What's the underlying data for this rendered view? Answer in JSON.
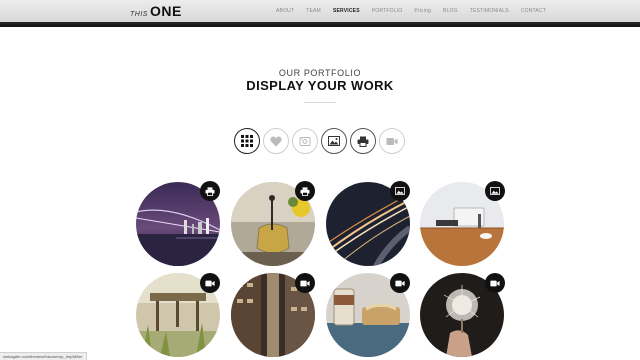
{
  "header": {
    "logo_prefix": "THIS",
    "logo_main": "ONE",
    "nav": [
      "ABOUT",
      "TEAM",
      "SERVICES",
      "PORTFOLIO",
      "Pricing",
      "BLOG",
      "TESTIMONIALS",
      "CONTACT"
    ],
    "active_nav": "SERVICES"
  },
  "portfolio": {
    "eyebrow": "OUR PORTFOLIO",
    "title": "DISPLAY YOUR WORK",
    "filters": [
      "grid-icon",
      "heart-icon",
      "camera-icon",
      "image-icon",
      "print-icon",
      "video-icon"
    ],
    "active_filter": "grid-icon",
    "items": [
      {
        "subject": "city bridge at night",
        "badge": "print-icon"
      },
      {
        "subject": "tea kettle with flowers",
        "badge": "print-icon"
      },
      {
        "subject": "light trails highway",
        "badge": "image-icon"
      },
      {
        "subject": "desk with computer",
        "badge": "image-icon"
      },
      {
        "subject": "wooden pier by lake",
        "badge": "video-icon"
      },
      {
        "subject": "narrow city alley",
        "badge": "video-icon"
      },
      {
        "subject": "coffee cup and pastry",
        "badge": "video-icon"
      },
      {
        "subject": "dandelion seed head",
        "badge": "video-icon"
      }
    ]
  },
  "colors": {
    "accent": "#111111",
    "header_bg": "#e4e4e4",
    "border": "#cfcfcf"
  },
  "status": {
    "url": "webagafe.com/themes/thisone/wp_tiny/Miller"
  }
}
